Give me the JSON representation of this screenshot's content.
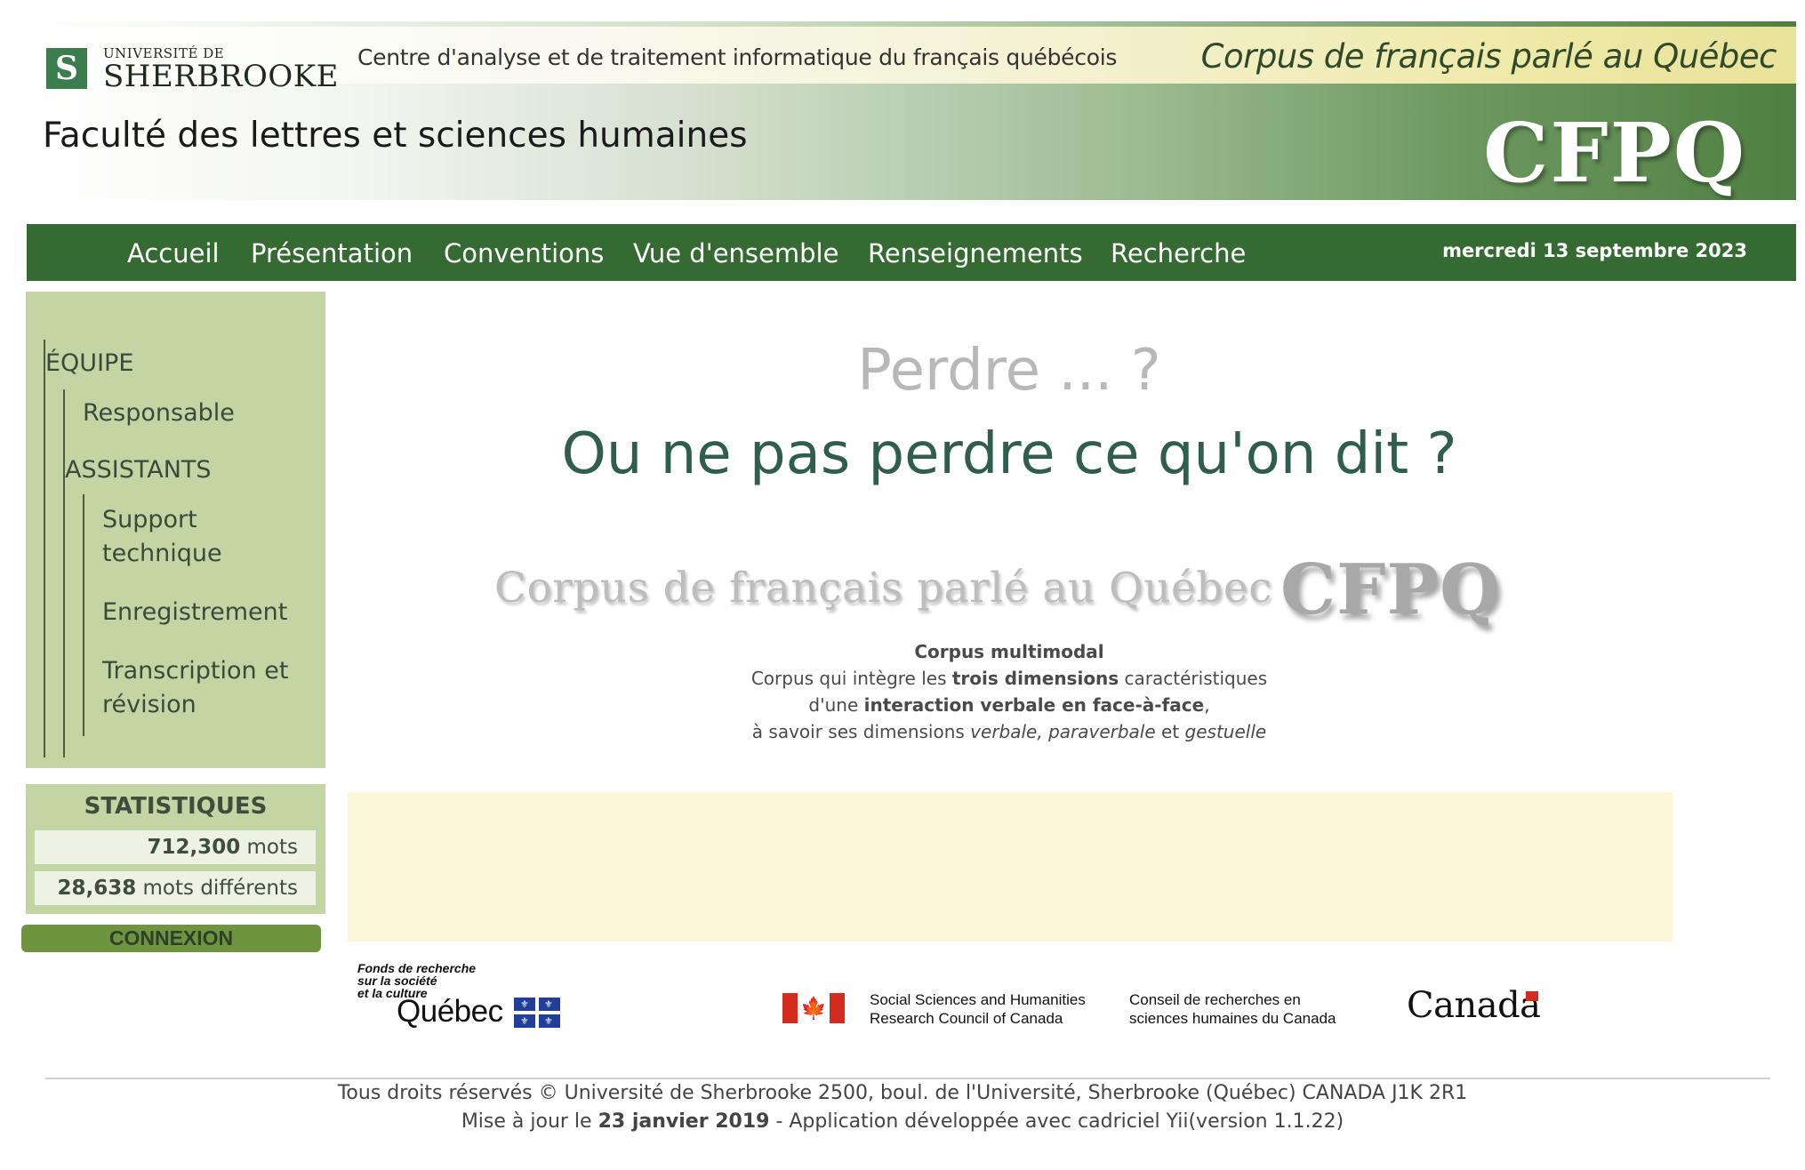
{
  "header": {
    "university_small": "UNIVERSITÉ DE",
    "university_name": "SHERBROOKE",
    "logo_letter": "S",
    "center_title": "Centre d'analyse et de traitement informatique du français québécois",
    "right_title": "Corpus de français parlé au Québec",
    "faculty": "Faculté des lettres et sciences humaines",
    "acronym": "CFPQ"
  },
  "nav": {
    "items": [
      {
        "label": "Accueil"
      },
      {
        "label": "Présentation"
      },
      {
        "label": "Conventions"
      },
      {
        "label": "Vue d'ensemble"
      },
      {
        "label": "Renseignements"
      },
      {
        "label": "Recherche"
      }
    ],
    "date": "mercredi 13 septembre 2023"
  },
  "sidebar": {
    "team_heading": "ÉQUIPE",
    "responsable": "Responsable",
    "assistants_heading": "ASSISTANTS",
    "support_1": "Support",
    "support_2": "technique",
    "enregistrement": "Enregistrement",
    "transcription_1": "Transcription et",
    "transcription_2": "révision"
  },
  "stats": {
    "title": "STATISTIQUES",
    "words_count": "712,300",
    "words_label": "mots",
    "distinct_count": "28,638",
    "distinct_label": "mots différents"
  },
  "login": {
    "label": "CONNEXION"
  },
  "main": {
    "headline_1": "Perdre ... ?",
    "headline_2": "Ou ne pas perdre ce qu'on dit ?",
    "corpus_logo_text": "Corpus de français parlé au Québec",
    "corpus_logo_acronym": "CFPQ",
    "desc_title": "Corpus multimodal",
    "desc_l2_a": "Corpus qui intègre les ",
    "desc_l2_b": "trois dimensions",
    "desc_l2_c": " caractéristiques",
    "desc_l3_a": "d'une ",
    "desc_l3_b": "interaction verbale en face-à-face",
    "desc_l3_c": ",",
    "desc_l4_a": "à savoir ses dimensions ",
    "desc_l4_b": "verbale, paraverbale",
    "desc_l4_c": " et ",
    "desc_l4_d": "gestuelle"
  },
  "sponsors": {
    "frq_line1": "Fonds de recherche",
    "frq_line2": "sur la société",
    "frq_line3": "et la culture",
    "frq_quebec": "Québec",
    "sshrc_en_1": "Social Sciences and Humanities",
    "sshrc_en_2": "Research Council of Canada",
    "sshrc_fr_1": "Conseil de recherches en",
    "sshrc_fr_2": "sciences humaines du Canada",
    "canada": "Canada"
  },
  "footer": {
    "line1": "Tous droits réservés © Université de Sherbrooke 2500, boul. de l'Université, Sherbrooke (Québec) CANADA J1K 2R1",
    "update_prefix": "Mise à jour le ",
    "update_date": "23 janvier 2019",
    "update_suffix": " - Application développée avec cadriciel Yii(version 1.1.22)"
  },
  "colors": {
    "nav_green": "#356a32",
    "sidebar_green": "#c4d5a4",
    "headline_green": "#2f5e4e",
    "login_green": "#6e9440",
    "yellow_box": "#fdf7da"
  }
}
